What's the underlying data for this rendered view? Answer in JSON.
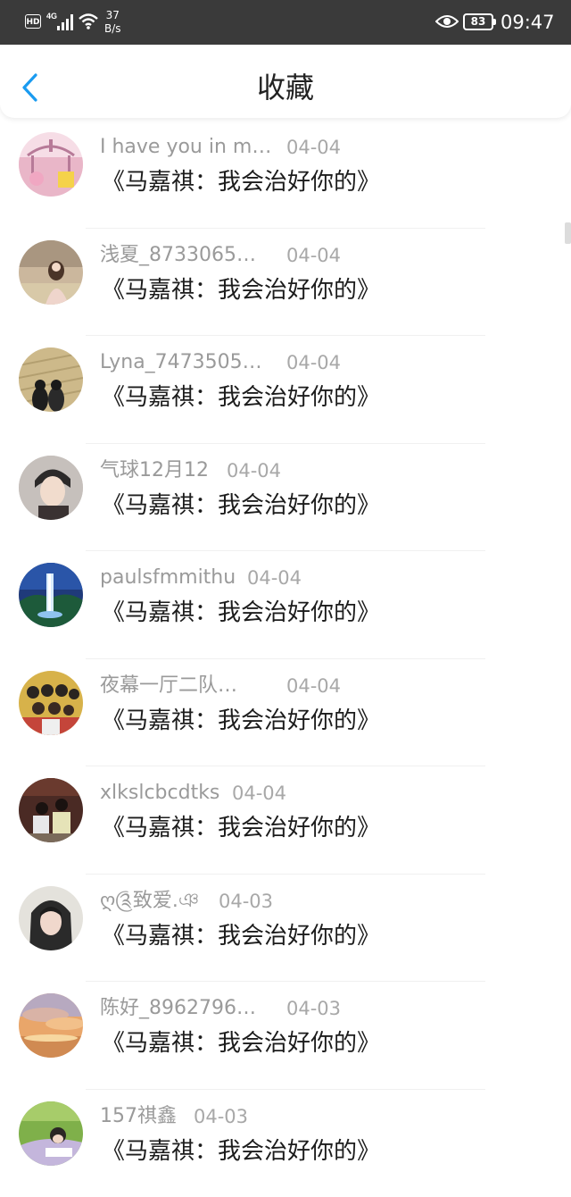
{
  "status_bar": {
    "hd": "HD",
    "net": "4G",
    "speed_value": "37",
    "speed_unit": "B/s",
    "battery": "83",
    "time": "09:47"
  },
  "header": {
    "title": "收藏",
    "back_icon": "chevron-left-icon",
    "accent": "#1a9bf0"
  },
  "items": [
    {
      "name": "I have you in m…",
      "date": "04-04",
      "title": "《马嘉祺：我会治好你的》"
    },
    {
      "name": "浅夏_8733065…",
      "date": "04-04",
      "title": "《马嘉祺：我会治好你的》"
    },
    {
      "name": "Lyna_7473505…",
      "date": "04-04",
      "title": "《马嘉祺：我会治好你的》"
    },
    {
      "name": "气球12月12",
      "date": "04-04",
      "title": "《马嘉祺：我会治好你的》"
    },
    {
      "name": "paulsfmmithu",
      "date": "04-04",
      "title": "《马嘉祺：我会治好你的》"
    },
    {
      "name": "夜幕一厅二队…",
      "date": "04-04",
      "title": "《马嘉祺：我会治好你的》"
    },
    {
      "name": "xlkslcbcdtks",
      "date": "04-04",
      "title": "《马嘉祺：我会治好你的》"
    },
    {
      "name": "ღ༊致爱.ঞ",
      "date": "04-03",
      "title": "《马嘉祺：我会治好你的》"
    },
    {
      "name": "陈好_8962796…",
      "date": "04-03",
      "title": "《马嘉祺：我会治好你的》"
    },
    {
      "name": "157祺鑫",
      "date": "04-03",
      "title": "《马嘉祺：我会治好你的》"
    }
  ]
}
